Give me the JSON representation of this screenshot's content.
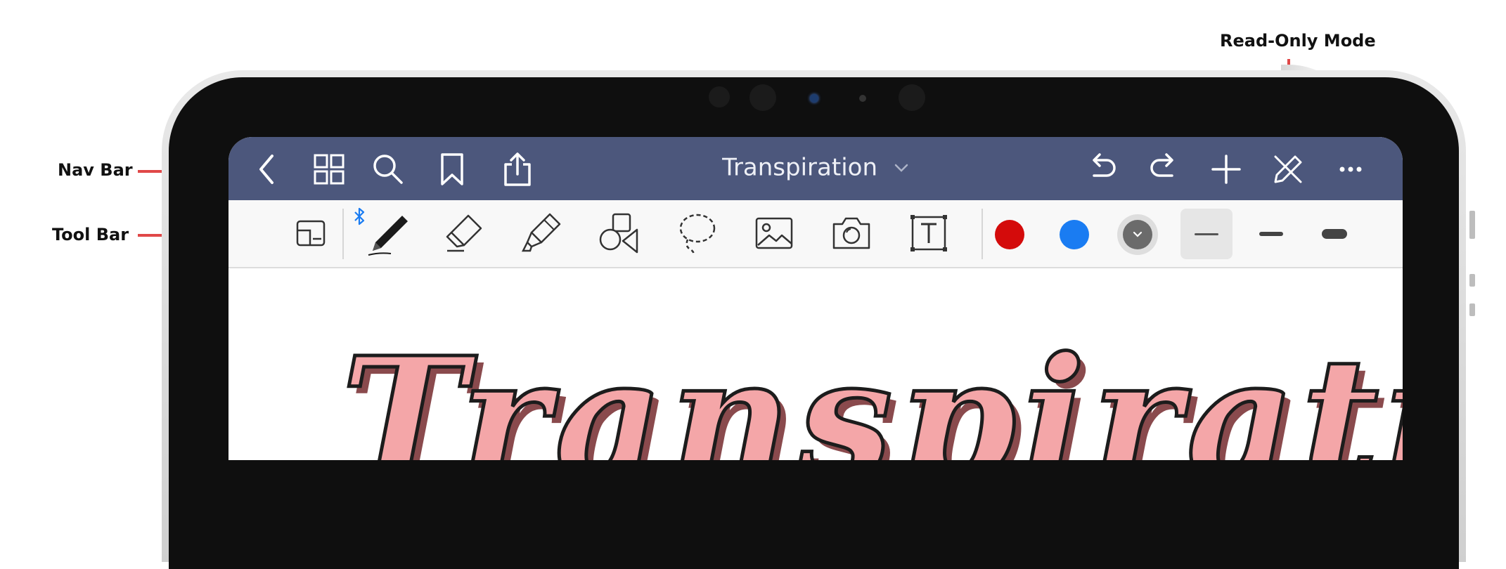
{
  "callouts": {
    "read_only": "Read-Only Mode",
    "nav_bar": "Nav Bar",
    "tool_bar": "Tool Bar"
  },
  "nav": {
    "title": "Transpiration",
    "left_icons": [
      "back-chevron",
      "grid",
      "search",
      "bookmark",
      "share"
    ],
    "right_icons": [
      "undo",
      "redo",
      "add",
      "read-only-pencil-slash",
      "more"
    ]
  },
  "toolbar": {
    "tools": [
      "page-layout",
      "pen",
      "eraser",
      "highlighter",
      "shapes",
      "lasso",
      "image",
      "camera",
      "text-box"
    ],
    "bluetooth_indicator": "bluetooth",
    "colors": [
      "#d40b0b",
      "#1a7cf2",
      "#6b6b6b"
    ],
    "stroke_widths": [
      "thin",
      "medium",
      "thick"
    ],
    "selected_stroke": "thin"
  },
  "canvas": {
    "handwriting": "Transpiration"
  },
  "accent_colors": {
    "nav_bar": "#4c577c",
    "callout_line": "#e04848",
    "ink": "#f4a6a8"
  }
}
